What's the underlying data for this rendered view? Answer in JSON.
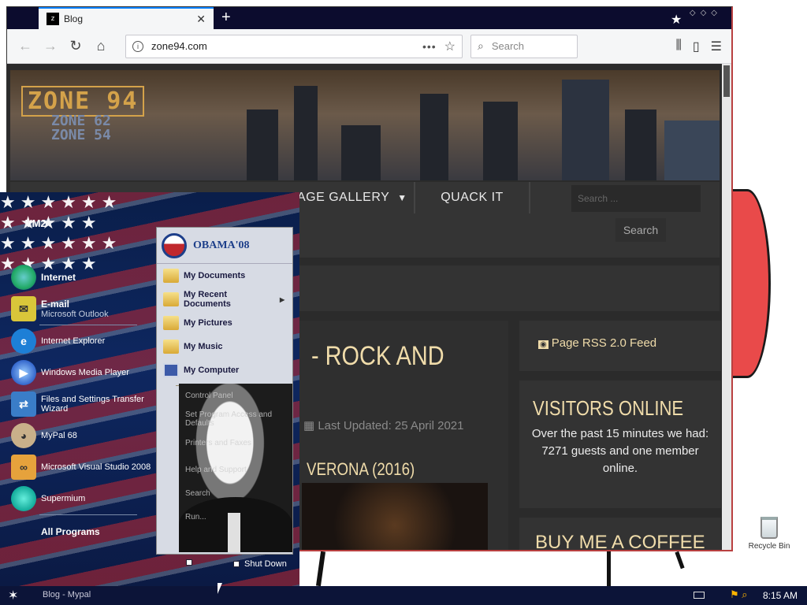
{
  "browser": {
    "tab_title": "Blog",
    "favicon_text": "z",
    "new_tab": "+",
    "url": "zone94.com",
    "search_placeholder": "Search"
  },
  "site": {
    "logo_main": "ZONE 94",
    "logo_sub1": "ZONE 62",
    "logo_sub2": "ZONE 54",
    "menu": [
      {
        "label": "AGE GALLERY"
      },
      {
        "label": "QUACK IT"
      }
    ],
    "search_placeholder": "Search ...",
    "search_button": "Search",
    "article_title": "- ROCK AND",
    "updated": "Last Updated: 25 April 2021",
    "subtitle": "VERONA (2016)",
    "rss": "Page RSS 2.0 Feed",
    "visitors_title": "VISITORS ONLINE",
    "visitors_text1": "Over the past 15 minutes we had:",
    "visitors_text2": "7271 guests and one member online.",
    "coffee_title": "BUY ME A COFFEE"
  },
  "startmenu": {
    "username": "VM2",
    "pinned": [
      {
        "label": "Internet",
        "sub": ""
      },
      {
        "label": "E-mail",
        "sub": "Microsoft Outlook"
      }
    ],
    "recent": [
      {
        "label": "Internet Explorer"
      },
      {
        "label": "Windows Media Player"
      },
      {
        "label": "Files and Settings Transfer Wizard"
      },
      {
        "label": "MyPal 68"
      },
      {
        "label": "Microsoft Visual Studio 2008"
      },
      {
        "label": "Supermium"
      }
    ],
    "all_programs": "All Programs",
    "right_logo": "OBAMA'08",
    "right_items": [
      {
        "label": "My Documents"
      },
      {
        "label": "My Recent Documents"
      },
      {
        "label": "My Pictures"
      },
      {
        "label": "My Music"
      },
      {
        "label": "My Computer"
      }
    ],
    "right_faded": [
      {
        "label": "Control Panel"
      },
      {
        "label": "Set Program Access and Defaults"
      },
      {
        "label": "Printers and Faxes"
      },
      {
        "label": "Help and Support"
      },
      {
        "label": "Search"
      },
      {
        "label": "Run..."
      }
    ],
    "shutdown": "Shut Down"
  },
  "desktop": {
    "recycle_bin": "Recycle Bin"
  },
  "taskbar": {
    "task_label": "Blog - Mypal",
    "time": "8:15 AM"
  }
}
